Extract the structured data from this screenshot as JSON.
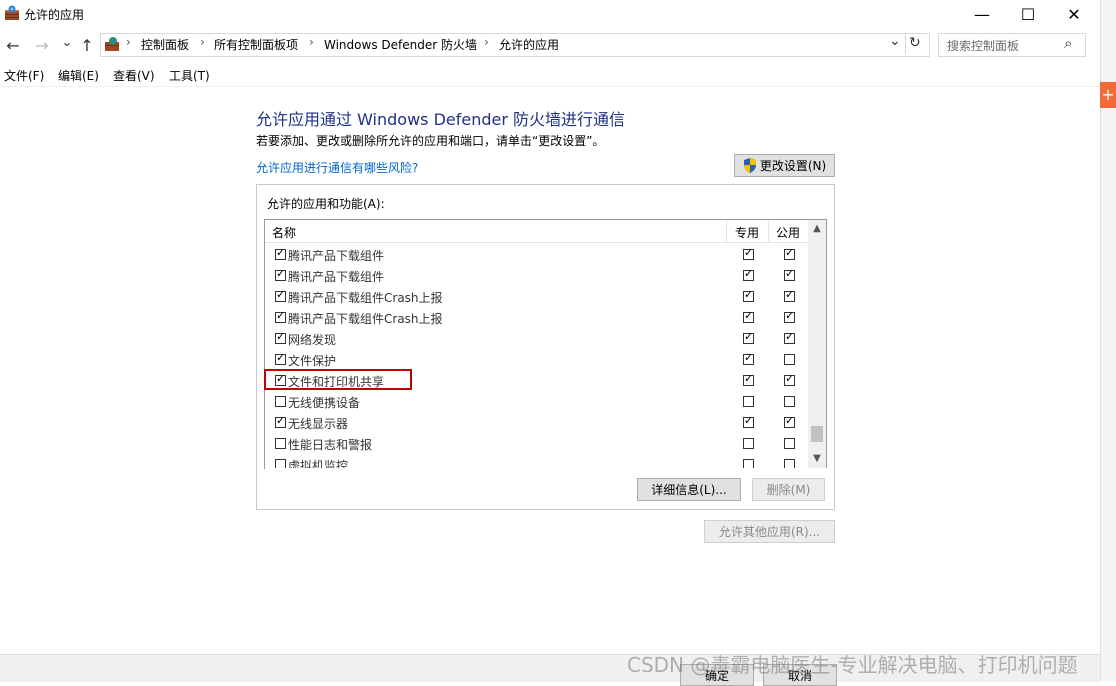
{
  "window": {
    "title": "允许的应用",
    "minimize": "—",
    "maximize": "☐",
    "close": "✕"
  },
  "nav": {
    "back": "←",
    "forward": "→",
    "recent": "⌄",
    "up": "↑",
    "breadcrumbs": [
      "控制面板",
      "所有控制面板项",
      "Windows Defender 防火墙",
      "允许的应用"
    ],
    "separator": "›",
    "refresh": "↻",
    "dropdown": "⌄",
    "search_placeholder": "搜索控制面板",
    "search_icon": "⌕"
  },
  "menu": [
    "文件(F)",
    "编辑(E)",
    "查看(V)",
    "工具(T)"
  ],
  "content": {
    "heading": "允许应用通过 Windows Defender 防火墙进行通信",
    "subtext": "若要添加、更改或删除所允许的应用和端口，请单击“更改设置”。",
    "risk_link": "允许应用进行通信有哪些风险?",
    "change_settings": "更改设置(N)",
    "group_label": "允许的应用和功能(A):",
    "columns": {
      "name": "名称",
      "private": "专用",
      "public": "公用"
    },
    "rows": [
      {
        "name": "腾讯产品下载组件",
        "enabled": true,
        "private": true,
        "public": true
      },
      {
        "name": "腾讯产品下载组件",
        "enabled": true,
        "private": true,
        "public": true
      },
      {
        "name": "腾讯产品下载组件Crash上报",
        "enabled": true,
        "private": true,
        "public": true
      },
      {
        "name": "腾讯产品下载组件Crash上报",
        "enabled": true,
        "private": true,
        "public": true
      },
      {
        "name": "网络发现",
        "enabled": true,
        "private": true,
        "public": true
      },
      {
        "name": "文件保护",
        "enabled": true,
        "private": true,
        "public": false
      },
      {
        "name": "文件和打印机共享",
        "enabled": true,
        "private": true,
        "public": true
      },
      {
        "name": "无线便携设备",
        "enabled": false,
        "private": false,
        "public": false
      },
      {
        "name": "无线显示器",
        "enabled": true,
        "private": true,
        "public": true
      },
      {
        "name": "性能日志和警报",
        "enabled": false,
        "private": false,
        "public": false
      },
      {
        "name": "虚拟机监控",
        "enabled": false,
        "private": false,
        "public": false
      }
    ],
    "details_button": "详细信息(L)...",
    "delete_button": "删除(M)",
    "allow_other_button": "允许其他应用(R)..."
  },
  "footer": {
    "ok": "确定",
    "cancel": "取消"
  },
  "watermark": "CSDN @毒霸电脑医生-专业解决电脑、打印机问题",
  "right_strip_glyph": "+"
}
